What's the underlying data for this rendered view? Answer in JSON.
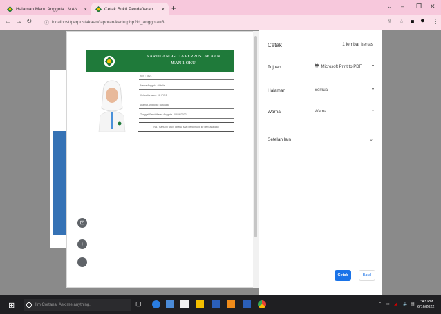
{
  "browser": {
    "tabs": [
      {
        "title": "Halaman Menu Anggota | MAN",
        "active": false
      },
      {
        "title": "Cetak Bukti Pendaftaran",
        "active": true
      }
    ],
    "url": "localhost/perpustakaan/laporan/kartu.php?id_anggota=3",
    "colors": {
      "tabstrip": "#f7c8dc",
      "toolbar": "#fbe0ea"
    }
  },
  "card": {
    "title_line1": "KARTU ANGGOTA PERPUSTAKAAN",
    "title_line2": "MAN 1 OKU",
    "fields": [
      "NIS : 5521",
      "Nama Anggota : Adelia",
      "Kelas/Jurusan : XII IPA 2",
      "Alamat Anggota : Baturaja",
      "Tanggal Pendaftaran Anggota : 08/06/2022"
    ],
    "footer": "NB.: Kartu ini wajib dibawa saat berkunjung ke perpustakaan",
    "colors": {
      "header": "#1f7a3a"
    }
  },
  "print_settings": {
    "title": "Cetak",
    "sheets": "1 lembar kertas",
    "rows": [
      {
        "label": "Tujuan",
        "value": "Microsoft Print to PDF"
      },
      {
        "label": "Halaman",
        "value": "Semua"
      },
      {
        "label": "Warna",
        "value": "Warna"
      }
    ],
    "more_settings": "Setelan lain",
    "print_label": "Cetak",
    "cancel_label": "Batal"
  },
  "taskbar": {
    "search_placeholder": "I'm Cortana. Ask me anything.",
    "time": "7:43 PM",
    "date": "6/16/2022"
  }
}
